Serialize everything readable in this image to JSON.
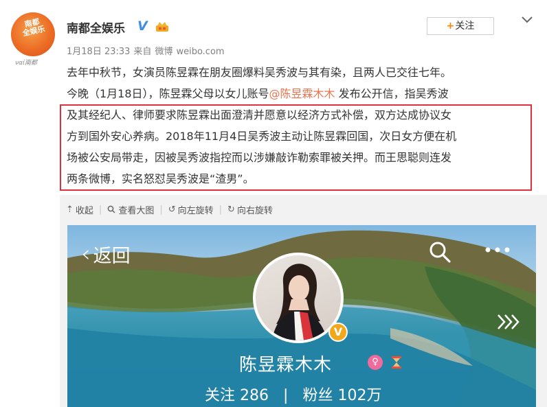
{
  "account": {
    "avatar_text": "南都\n全娱乐",
    "avatar_tag": "ναί南都",
    "name": "南都全娱乐",
    "verified_mark": "V",
    "crown_icon": "crown-icon"
  },
  "meta": {
    "time": "1月18日 23:33",
    "source_prefix": "来自",
    "source_app": "微博",
    "source_site": "weibo.com"
  },
  "follow": {
    "plus": "+",
    "label": "关注"
  },
  "post": {
    "line1": "去年中秋节，女演员陈昱霖在朋友圈爆料吴秀波与其有染，且两人已交往七年。",
    "line2_before": "今晚（1月18日），陈昱霖父母以女儿账号",
    "line2_mention": "@陈昱霖木木",
    "line2_after": " 发布公开信，指吴秀波",
    "line3": "及其经纪人、律师要求陈昱霖出面澄清并愿意以经济方式补偿，双方达成协议女",
    "line4": "方到国外安心养病。2018年11月4日吴秀波主动让陈昱霖回国，次日女方便在机",
    "line5": "场被公安局带走，因被吴秀波指控而以涉嫌敲诈勒索罪被关押。而王思聪则连发",
    "line6": "两条微博，实名怒怼吴秀波是“渣男”。"
  },
  "toolbar": {
    "collapse": "收起",
    "view_large": "查看大图",
    "rotate_left": "向左旋转",
    "rotate_right": "向右旋转"
  },
  "profile_card": {
    "back_label": "返回",
    "name": "陈昱霖木木",
    "verified_mark": "V",
    "following_label": "关注",
    "following_count": "286",
    "stat_divider": "|",
    "followers_label": "粉丝",
    "followers_count": "102万"
  },
  "colors": {
    "mention": "#eb7350",
    "highlight_border": "#e0303c",
    "follow_plus": "#ff8200",
    "verified_blue": "#3c8ee6",
    "gold_badge": "#f3a81b"
  }
}
